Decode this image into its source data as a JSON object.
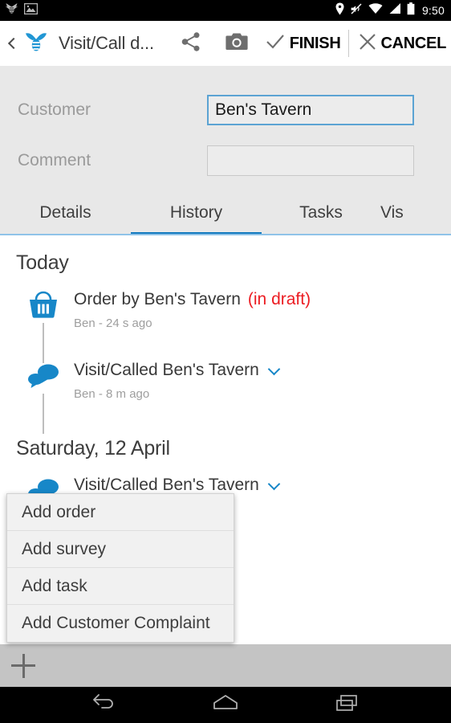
{
  "statusbar": {
    "clock": "9:50",
    "left_icons": [
      "app-bee-icon",
      "screenshot-image-icon"
    ],
    "right_icons": [
      "location-pin-icon",
      "vibrate-mute-icon",
      "wifi-icon",
      "cellular-signal-icon",
      "battery-icon"
    ]
  },
  "appbar": {
    "back_icon": "back-chevron-icon",
    "logo_icon": "bee-logo-icon",
    "title": "Visit/Call d...",
    "share_icon": "share-icon",
    "camera_icon": "camera-icon",
    "finish_label": "FINISH",
    "finish_icon": "check-icon",
    "cancel_label": "CANCEL",
    "cancel_icon": "close-x-icon"
  },
  "form": {
    "customer": {
      "label": "Customer",
      "value": "Ben's Tavern",
      "placeholder": ""
    },
    "comment": {
      "label": "Comment",
      "value": "",
      "placeholder": ""
    }
  },
  "tabs": {
    "items": [
      {
        "label": "Details",
        "selected": false
      },
      {
        "label": "History",
        "selected": true
      },
      {
        "label": "Tasks",
        "selected": false
      },
      {
        "label": "Vis",
        "selected": false
      }
    ],
    "accent_color": "#1179bf"
  },
  "history": {
    "groups": [
      {
        "title": "Today",
        "entries": [
          {
            "icon": "shopping-basket-icon",
            "title": "Order by Ben's Tavern",
            "status": "(in draft)",
            "status_color": "#ec1c22",
            "subtitle": "Ben - 24 s ago",
            "has_chevron": false
          },
          {
            "icon": "speech-bubbles-icon",
            "title": "Visit/Called Ben's Tavern",
            "status": "",
            "subtitle": "Ben - 8 m ago",
            "has_chevron": true
          }
        ]
      },
      {
        "title": "Saturday, 12 April",
        "entries": [
          {
            "icon": "speech-bubbles-icon",
            "title": "Visit/Called Ben's Tavern",
            "status": "",
            "subtitle": "",
            "has_chevron": true
          }
        ]
      }
    ]
  },
  "popup_menu": {
    "items": [
      {
        "label": "Add order"
      },
      {
        "label": "Add survey"
      },
      {
        "label": "Add task"
      },
      {
        "label": "Add Customer Complaint"
      }
    ]
  },
  "bottombar": {
    "add_icon": "plus-icon"
  },
  "navbar": {
    "back_icon": "nav-back-icon",
    "home_icon": "nav-home-icon",
    "recents_icon": "nav-recents-icon"
  },
  "colors": {
    "accent_blue": "#1787c8",
    "tab_indicator": "#1179bf",
    "draft_red": "#ec1c22",
    "form_bg": "#e8e8e8",
    "focus_border": "#5ba3d3"
  }
}
